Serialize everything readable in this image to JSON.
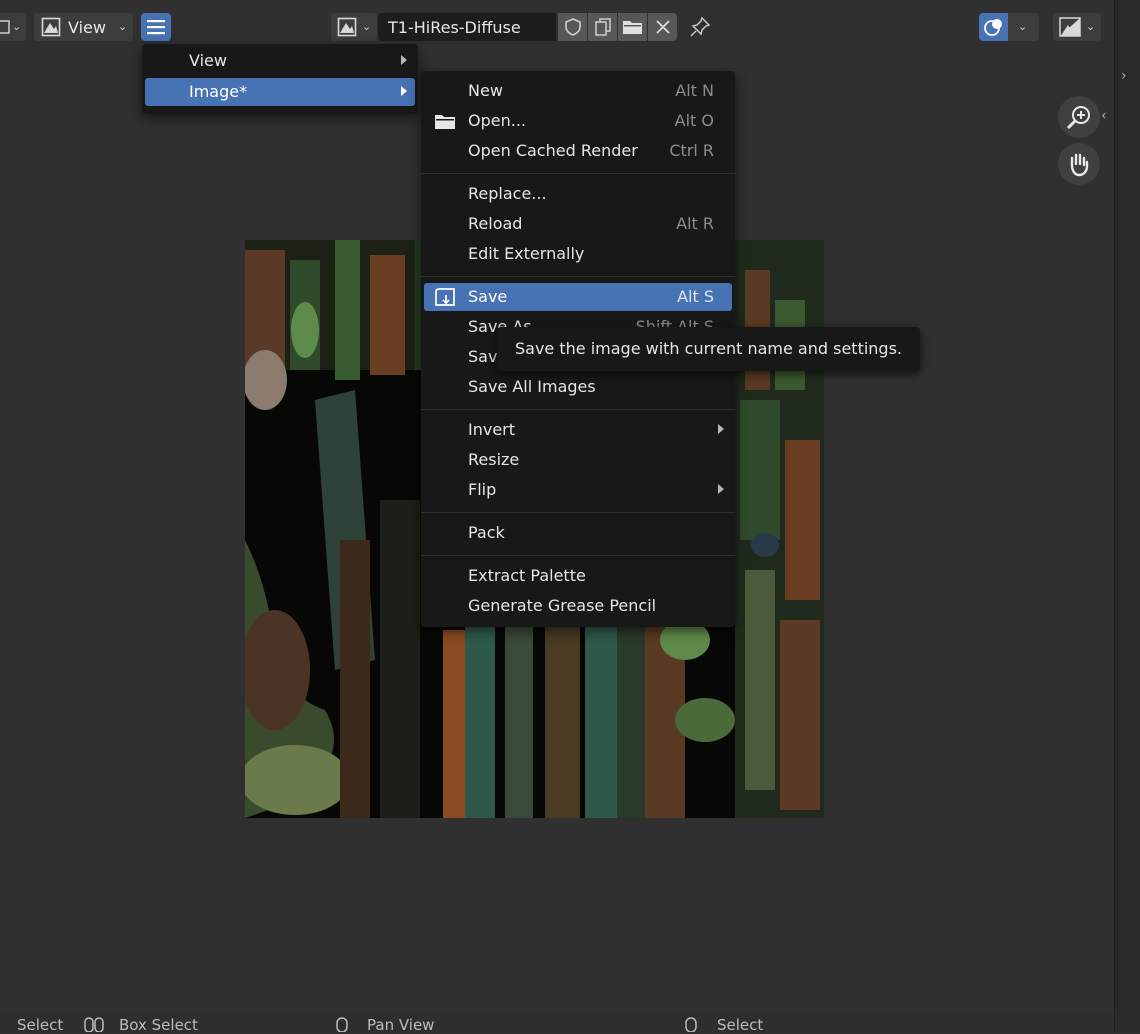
{
  "header": {
    "view_label": "View",
    "image_name": "T1-HiRes-Diffuse"
  },
  "viewer_menu": {
    "items": [
      {
        "label": "View",
        "has_submenu": true
      },
      {
        "label": "Image*",
        "has_submenu": true,
        "active": true
      }
    ]
  },
  "image_menu": {
    "items": [
      {
        "label": "New",
        "shortcut": "Alt N"
      },
      {
        "label": "Open...",
        "shortcut": "Alt O",
        "icon": "folder-icon"
      },
      {
        "label": "Open Cached Render",
        "shortcut": "Ctrl R"
      },
      {
        "label": "Replace...",
        "shortcut": ""
      },
      {
        "label": "Reload",
        "shortcut": "Alt R"
      },
      {
        "label": "Edit Externally",
        "shortcut": ""
      },
      {
        "label": "Save",
        "shortcut": "Alt S",
        "icon": "save-icon",
        "active": true
      },
      {
        "label": "Save As...",
        "shortcut": "Shift Alt S"
      },
      {
        "label": "Save a Copy...",
        "shortcut": ""
      },
      {
        "label": "Save All Images",
        "shortcut": ""
      },
      {
        "label": "Invert",
        "has_submenu": true
      },
      {
        "label": "Resize",
        "shortcut": ""
      },
      {
        "label": "Flip",
        "has_submenu": true
      },
      {
        "label": "Pack",
        "shortcut": ""
      },
      {
        "label": "Extract Palette",
        "shortcut": ""
      },
      {
        "label": "Generate Grease Pencil",
        "shortcut": ""
      }
    ]
  },
  "tooltip": {
    "text": "Save the image with current name and settings."
  },
  "status_bar": {
    "items": [
      "Select",
      "Box Select",
      "Pan View",
      "Select"
    ]
  },
  "colors": {
    "accent": "#4772b3",
    "menu_bg": "#181818",
    "panel_bg": "#303030"
  }
}
